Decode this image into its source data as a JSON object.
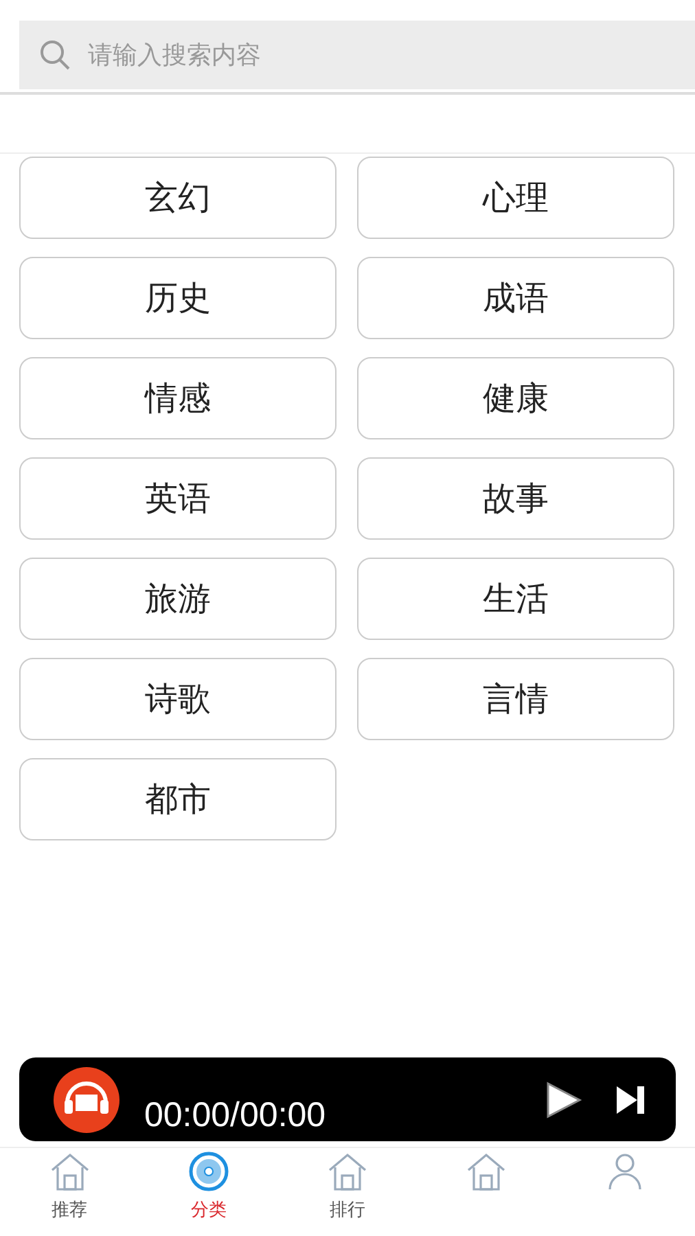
{
  "search": {
    "placeholder": "请输入搜索内容"
  },
  "categories": [
    "玄幻",
    "心理",
    "历史",
    "成语",
    "情感",
    "健康",
    "英语",
    "故事",
    "旅游",
    "生活",
    "诗歌",
    "言情",
    "都市"
  ],
  "player": {
    "time": "00:00/00:00"
  },
  "tabs": [
    {
      "label": "推荐",
      "selected": false
    },
    {
      "label": "分类",
      "selected": true
    },
    {
      "label": "排行",
      "selected": false
    },
    {
      "selected": false
    },
    {
      "selected": false
    }
  ]
}
